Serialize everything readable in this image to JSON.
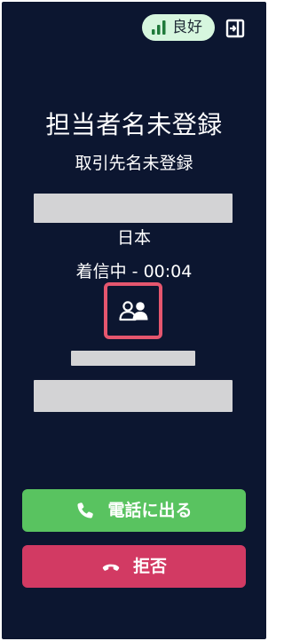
{
  "status": {
    "signal_label": "良好",
    "signal_color": "#1f7a3a"
  },
  "caller": {
    "contact_name": "担当者名未登録",
    "company_name": "取引先名未登録",
    "country": "日本"
  },
  "call": {
    "status_text": "着信中 - 00:04"
  },
  "actions": {
    "answer_label": "電話に出る",
    "decline_label": "拒否"
  },
  "icons": {
    "signal": "signal-bars-icon",
    "panel_toggle": "panel-collapse-icon",
    "contacts": "contacts-icon",
    "answer": "phone-icon",
    "decline": "phone-hangup-icon"
  },
  "colors": {
    "background": "#0c1630",
    "answer": "#59c360",
    "decline": "#d23a63",
    "highlight": "#e5566e",
    "badge_bg": "#d6f6de"
  }
}
